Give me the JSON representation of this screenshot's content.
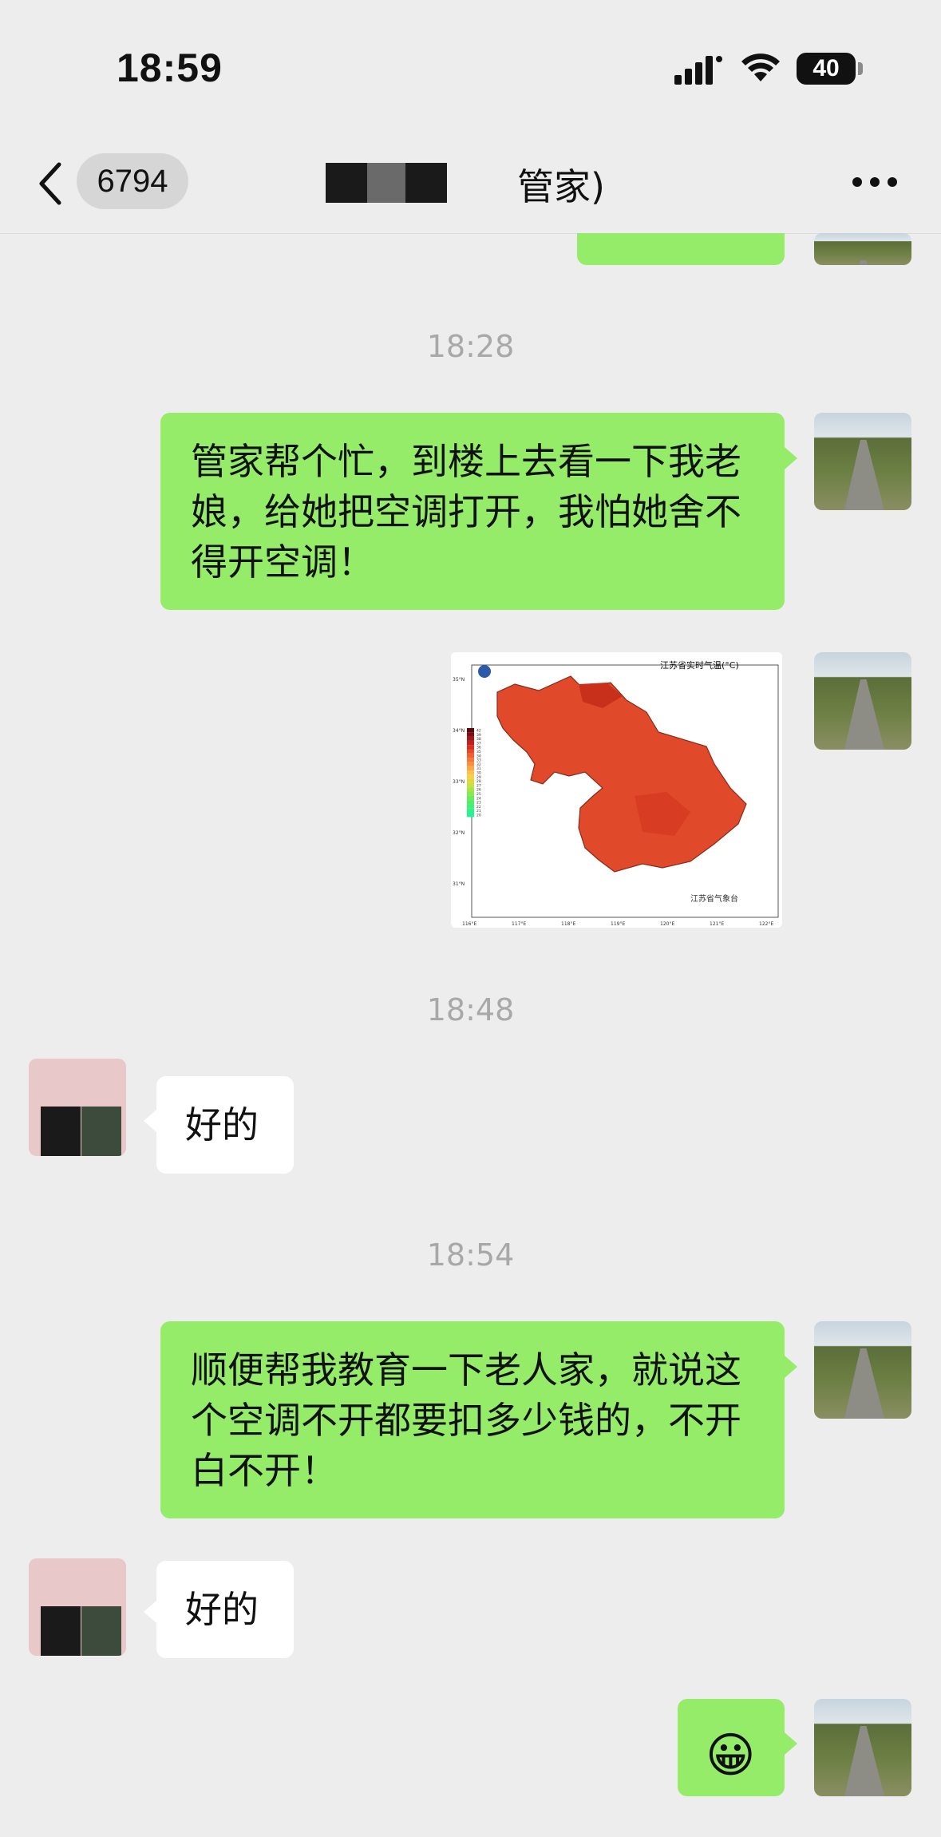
{
  "status_bar": {
    "time": "18:59",
    "battery": "40"
  },
  "nav": {
    "back_count": "6794",
    "title": "管家)"
  },
  "timestamps": [
    "18:28",
    "18:48",
    "18:54"
  ],
  "messages": [
    {
      "from": "me",
      "text": "管家帮个忙，到楼上去看一下我老娘，给她把空调打开，我怕她舍不得开空调！"
    },
    {
      "from": "me",
      "type": "image"
    },
    {
      "from": "them",
      "text": "好的"
    },
    {
      "from": "me",
      "text": "顺便帮我教育一下老人家，就说这个空调不开都要扣多少钱的，不开白不开！"
    },
    {
      "from": "them",
      "text": "好的"
    },
    {
      "from": "me",
      "type": "emoji",
      "text": "😀"
    }
  ],
  "map_image": {
    "title": "江苏省实时气温(°C)",
    "source": "江苏省气象台",
    "lat_labels": [
      "35°N",
      "34°N",
      "33°N",
      "32°N",
      "31°N"
    ],
    "lon_labels": [
      "116°E",
      "117°E",
      "118°E",
      "119°E",
      "120°E",
      "121°E",
      "122°E"
    ],
    "legend_values": [
      "42",
      "39",
      "38",
      "37",
      "36",
      "35",
      "34",
      "33",
      "32",
      "31",
      "30",
      "29",
      "28",
      "27",
      "26",
      "25",
      "24",
      "23",
      "22",
      "21",
      "20"
    ],
    "legend_colors": [
      "#5a0a0a",
      "#7a1010",
      "#a01818",
      "#c02020",
      "#d83020",
      "#e84828",
      "#f06030",
      "#f57838",
      "#f89040",
      "#fba848",
      "#fdc050",
      "#f5d048",
      "#e0d840",
      "#c8e040",
      "#a8e448",
      "#88e850",
      "#68ec58",
      "#50ee68",
      "#40f078",
      "#30f288",
      "#20f498"
    ]
  }
}
